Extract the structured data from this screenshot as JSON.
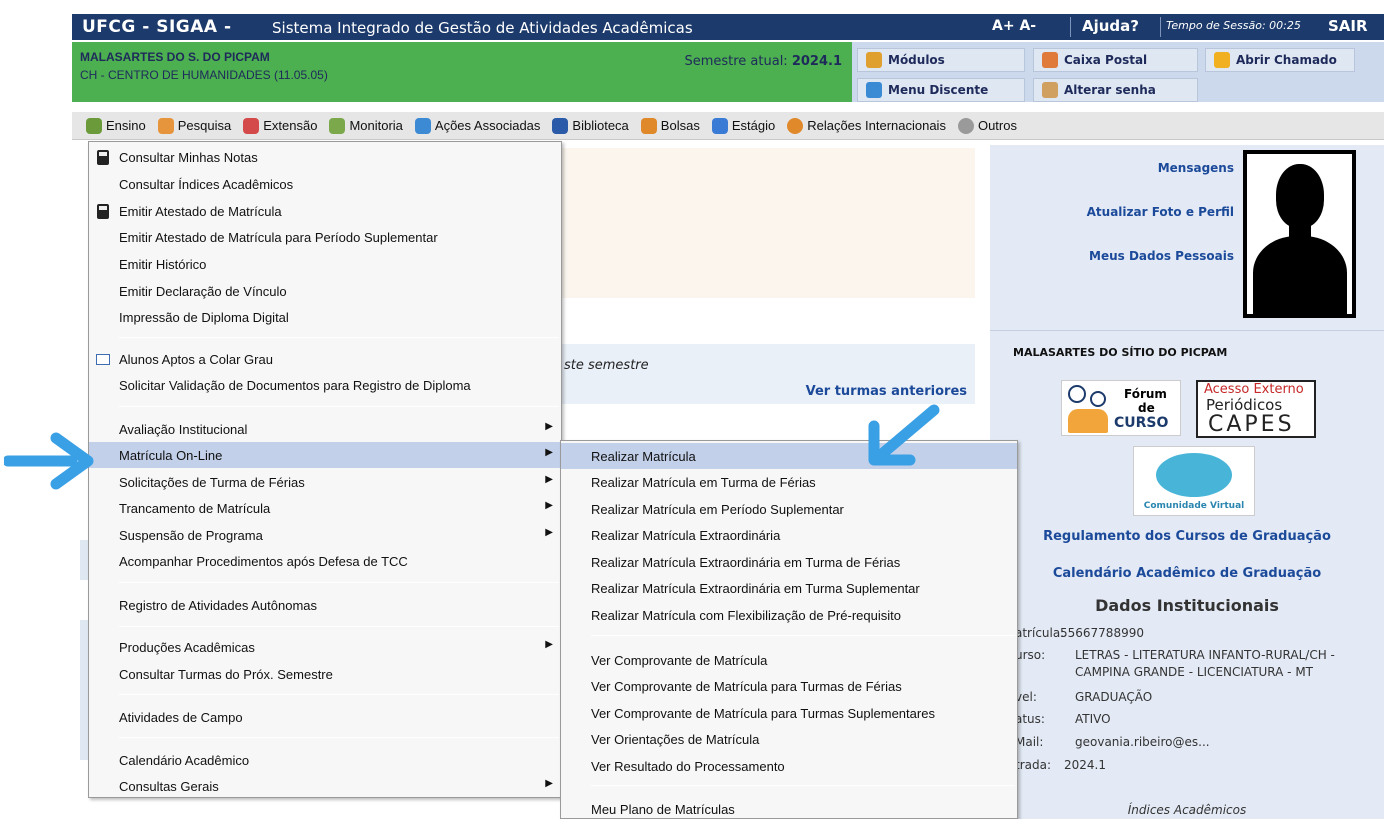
{
  "topbar": {
    "brand": "UFCG - SIGAA -",
    "subtitle": "Sistema Integrado de Gestão de Atividades Acadêmicas",
    "font_ctrl": "A+ A-",
    "help": "Ajuda?",
    "session": "Tempo de Sessão: 00:25",
    "exit": "SAIR"
  },
  "user": {
    "name": "MALASARTES DO S. DO PICPAM",
    "center": "CH - CENTRO DE HUMANIDADES (11.05.05)",
    "semester_label": "Semestre atual:",
    "semester_value": "2024.1"
  },
  "header_buttons": {
    "modulos": "Módulos",
    "caixa_postal": "Caixa Postal",
    "abrir_chamado": "Abrir Chamado",
    "menu_discente": "Menu Discente",
    "alterar_senha": "Alterar senha"
  },
  "menubar": {
    "items": [
      {
        "label": "Ensino",
        "icon": "books-icon",
        "color": "#6b9a3a"
      },
      {
        "label": "Pesquisa",
        "icon": "flask-icon",
        "color": "#e6953c"
      },
      {
        "label": "Extensão",
        "icon": "handshake-icon",
        "color": "#d44a4a"
      },
      {
        "label": "Monitoria",
        "icon": "teacher-icon",
        "color": "#7aa84a"
      },
      {
        "label": "Ações Associadas",
        "icon": "puzzle-icon",
        "color": "#3c8ad4"
      },
      {
        "label": "Biblioteca",
        "icon": "book-icon",
        "color": "#2a5aa8"
      },
      {
        "label": "Bolsas",
        "icon": "user-icon",
        "color": "#e0892b"
      },
      {
        "label": "Estágio",
        "icon": "card-icon",
        "color": "#3a7bd5"
      },
      {
        "label": "Relações Internacionais",
        "icon": "globe-icon",
        "color": "#e0892b"
      },
      {
        "label": "Outros",
        "icon": "gears-icon",
        "color": "#9a9a9a"
      }
    ]
  },
  "main": {
    "turmas_text": "ste semestre",
    "ver_turmas": "Ver turmas anteriores"
  },
  "ensino_menu": {
    "items": [
      {
        "label": "Consultar Minhas Notas"
      },
      {
        "label": "Consultar Índices Acadêmicos"
      },
      {
        "label": "Emitir Atestado de Matrícula"
      },
      {
        "label": "Emitir Atestado de Matrícula para Período Suplementar"
      },
      {
        "label": "Emitir Histórico"
      },
      {
        "label": "Emitir Declaração de Vínculo"
      },
      {
        "label": "Impressão de Diploma Digital"
      },
      {
        "label": "Alunos Aptos a Colar Grau"
      },
      {
        "label": "Solicitar Validação de Documentos para Registro de Diploma"
      },
      {
        "label": "Avaliação Institucional"
      },
      {
        "label": "Matrícula On-Line"
      },
      {
        "label": "Solicitações de Turma de Férias"
      },
      {
        "label": "Trancamento de Matrícula"
      },
      {
        "label": "Suspensão de Programa"
      },
      {
        "label": "Acompanhar Procedimentos após Defesa de TCC"
      },
      {
        "label": "Registro de Atividades Autônomas"
      },
      {
        "label": "Produções Acadêmicas"
      },
      {
        "label": "Consultar Turmas do Próx. Semestre"
      },
      {
        "label": "Atividades de Campo"
      },
      {
        "label": "Calendário Acadêmico"
      },
      {
        "label": "Consultas Gerais"
      }
    ]
  },
  "matricula_menu": {
    "items": [
      {
        "label": "Realizar Matrícula"
      },
      {
        "label": "Realizar Matrícula em Turma de Férias"
      },
      {
        "label": "Realizar Matrícula em Período Suplementar"
      },
      {
        "label": "Realizar Matrícula Extraordinária"
      },
      {
        "label": "Realizar Matrícula Extraordinária em Turma de Férias"
      },
      {
        "label": "Realizar Matrícula Extraordinária em Turma Suplementar"
      },
      {
        "label": "Realizar Matrícula com Flexibilização de Pré-requisito"
      },
      {
        "label": "Ver Comprovante de Matrícula"
      },
      {
        "label": "Ver Comprovante de Matrícula para Turmas de Férias"
      },
      {
        "label": "Ver Comprovante de Matrícula para Turmas Suplementares"
      },
      {
        "label": "Ver Orientações de Matrícula"
      },
      {
        "label": "Ver Resultado do Processamento"
      },
      {
        "label": "Meu Plano de Matrículas"
      }
    ]
  },
  "sidebar": {
    "mensagens": "Mensagens",
    "atualizar_foto": "Atualizar Foto e Perfil",
    "meus_dados": "Meus Dados Pessoais",
    "user_caps": "MALASARTES DO SÍTIO DO PICPAM",
    "forum_1": "Fórum",
    "forum_2": "de",
    "forum_3": "CURSO",
    "capes_1": "Acesso Externo",
    "capes_2": "Periódicos",
    "capes_3": "CAPES",
    "comunidade": "Comunidade Virtual",
    "regulamento": "Regulamento dos Cursos de Graduação",
    "calendario": "Calendário Acadêmico de Graduação",
    "dados_title": "Dados Institucionais",
    "matricula_key": "atrícula:",
    "matricula_val": "55667788990",
    "curso_key": "urso:",
    "curso_val_1": "LETRAS - LITERATURA INFANTO-RURAL/CH -",
    "curso_val_2": "CAMPINA GRANDE - LICENCIATURA - MT",
    "nivel_key": "vel:",
    "nivel_val": "GRADUAÇÃO",
    "status_key": "atus:",
    "status_val": "ATIVO",
    "email_key": "Mail:",
    "email_val": "geovania.ribeiro@es...",
    "entrada_key": "trada:",
    "entrada_val": "2024.1",
    "indices": "Índices Acadêmicos"
  },
  "colors": {
    "topbar": "#1c3a6b",
    "user_header": "#4caf50",
    "annotation_arrow": "#3aa0e6",
    "menu_highlight": "#c3d0ea"
  }
}
